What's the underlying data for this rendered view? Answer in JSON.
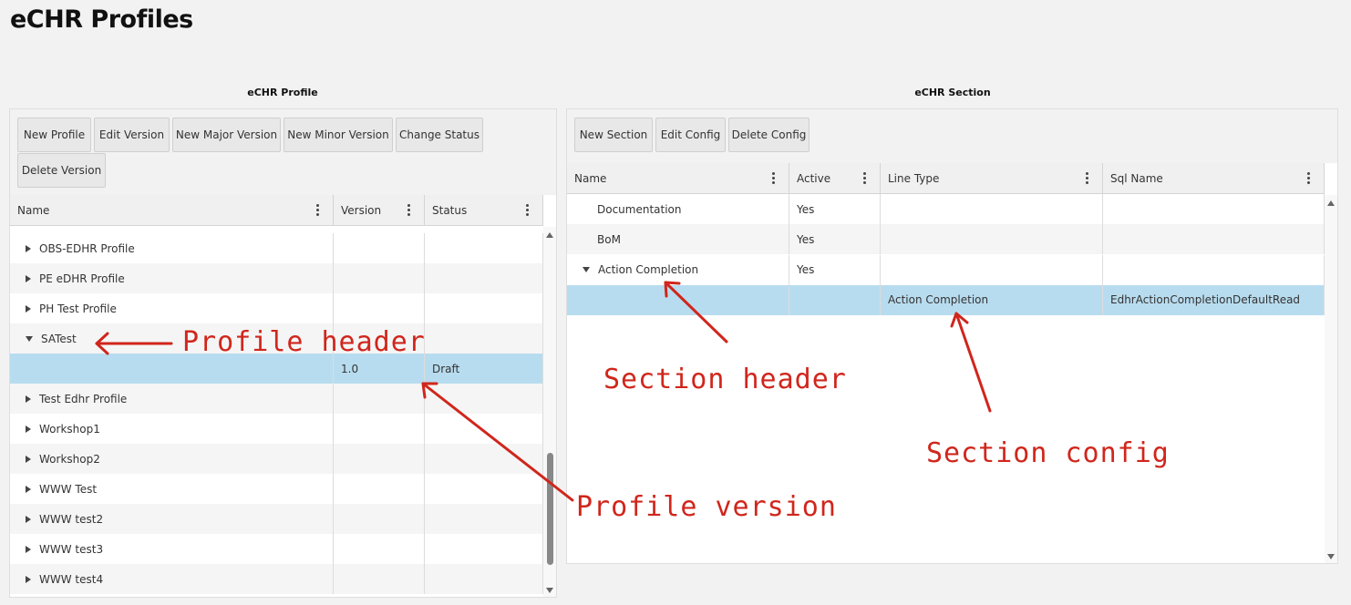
{
  "page": {
    "title": "eCHR Profiles"
  },
  "profile_panel": {
    "title": "eCHR Profile",
    "buttons": [
      "New Profile",
      "Edit Version",
      "New Major Version",
      "New Minor Version",
      "Change Status",
      "Delete Version"
    ],
    "columns": [
      "Name",
      "Version",
      "Status"
    ],
    "rows": [
      {
        "name": "OBS-EDHR Profile",
        "version": "",
        "status": "",
        "toggle": "collapsed"
      },
      {
        "name": "PE eDHR Profile",
        "version": "",
        "status": "",
        "toggle": "collapsed"
      },
      {
        "name": "PH Test Profile",
        "version": "",
        "status": "",
        "toggle": "collapsed"
      },
      {
        "name": "SATest",
        "version": "",
        "status": "",
        "toggle": "expanded"
      },
      {
        "name": "",
        "version": "1.0",
        "status": "Draft",
        "toggle": "none",
        "selected": true
      },
      {
        "name": "Test Edhr Profile",
        "version": "",
        "status": "",
        "toggle": "collapsed"
      },
      {
        "name": "Workshop1",
        "version": "",
        "status": "",
        "toggle": "collapsed"
      },
      {
        "name": "Workshop2",
        "version": "",
        "status": "",
        "toggle": "collapsed"
      },
      {
        "name": "WWW Test",
        "version": "",
        "status": "",
        "toggle": "collapsed"
      },
      {
        "name": "WWW test2",
        "version": "",
        "status": "",
        "toggle": "collapsed"
      },
      {
        "name": "WWW test3",
        "version": "",
        "status": "",
        "toggle": "collapsed"
      },
      {
        "name": "WWW test4",
        "version": "",
        "status": "",
        "toggle": "collapsed"
      }
    ]
  },
  "section_panel": {
    "title": "eCHR Section",
    "buttons": [
      "New Section",
      "Edit Config",
      "Delete Config"
    ],
    "columns": [
      "Name",
      "Active",
      "Line Type",
      "Sql Name"
    ],
    "rows": [
      {
        "name": "Documentation",
        "active": "Yes",
        "line_type": "",
        "sql_name": "",
        "toggle": "none"
      },
      {
        "name": "BoM",
        "active": "Yes",
        "line_type": "",
        "sql_name": "",
        "toggle": "none"
      },
      {
        "name": "Action Completion",
        "active": "Yes",
        "line_type": "",
        "sql_name": "",
        "toggle": "expanded"
      },
      {
        "name": "",
        "active": "",
        "line_type": "Action Completion",
        "sql_name": "EdhrActionCompletionDefaultRead",
        "toggle": "none",
        "selected": true
      }
    ]
  },
  "annotations": {
    "profile_header": "Profile header",
    "profile_version": "Profile version",
    "section_header": "Section header",
    "section_config": "Section config"
  },
  "colors": {
    "selection": "#b8dcef",
    "annotation": "#d0261c"
  }
}
